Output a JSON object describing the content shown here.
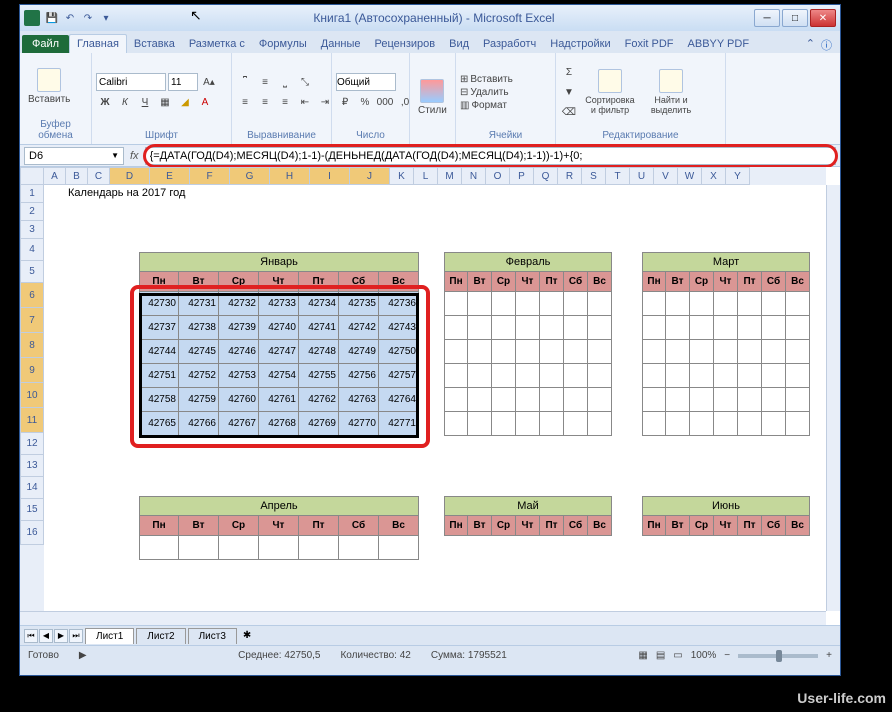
{
  "title": "Книга1 (Автосохраненный) - Microsoft Excel",
  "tabs": {
    "file": "Файл",
    "list": [
      "Главная",
      "Вставка",
      "Разметка с",
      "Формулы",
      "Данные",
      "Рецензиров",
      "Вид",
      "Разработч",
      "Надстройки",
      "Foxit PDF",
      "ABBYY PDF"
    ],
    "active": 0
  },
  "ribbon": {
    "clipboard": {
      "paste": "Вставить",
      "label": "Буфер обмена"
    },
    "font": {
      "name": "Calibri",
      "size": "11",
      "label": "Шрифт"
    },
    "align": {
      "label": "Выравнивание"
    },
    "number": {
      "format": "Общий",
      "label": "Число"
    },
    "styles": {
      "label": "Стили"
    },
    "cells": {
      "insert": "Вставить",
      "delete": "Удалить",
      "format": "Формат",
      "label": "Ячейки"
    },
    "editing": {
      "sort": "Сортировка и фильтр",
      "find": "Найти и выделить",
      "label": "Редактирование"
    }
  },
  "namebox": "D6",
  "formula": "{=ДАТА(ГОД(D4);МЕСЯЦ(D4);1-1)-(ДЕНЬНЕД(ДАТА(ГОД(D4);МЕСЯЦ(D4);1-1))-1)+{0;",
  "columns": [
    "A",
    "B",
    "C",
    "D",
    "E",
    "F",
    "G",
    "H",
    "I",
    "J",
    "K",
    "L",
    "M",
    "N",
    "O",
    "P",
    "Q",
    "R",
    "S",
    "T",
    "U",
    "V",
    "W",
    "X",
    "Y"
  ],
  "rows": [
    1,
    2,
    3,
    4,
    5,
    6,
    7,
    8,
    9,
    10,
    11,
    12,
    13,
    14,
    15,
    16
  ],
  "selected_rows": [
    6,
    7,
    8,
    9,
    10,
    11
  ],
  "cell_a1": "Календарь на 2017 год",
  "months": {
    "jan": "Январь",
    "feb": "Февраль",
    "mar": "Март",
    "apr": "Апрель",
    "may": "Май",
    "jun": "Июнь"
  },
  "days": [
    "Пн",
    "Вт",
    "Ср",
    "Чт",
    "Пт",
    "Сб",
    "Вс"
  ],
  "jan_data": [
    [
      42730,
      42731,
      42732,
      42733,
      42734,
      42735,
      42736
    ],
    [
      42737,
      42738,
      42739,
      42740,
      42741,
      42742,
      42743
    ],
    [
      42744,
      42745,
      42746,
      42747,
      42748,
      42749,
      42750
    ],
    [
      42751,
      42752,
      42753,
      42754,
      42755,
      42756,
      42757
    ],
    [
      42758,
      42759,
      42760,
      42761,
      42762,
      42763,
      42764
    ],
    [
      42765,
      42766,
      42767,
      42768,
      42769,
      42770,
      42771
    ]
  ],
  "sheets": [
    "Лист1",
    "Лист2",
    "Лист3"
  ],
  "status": {
    "ready": "Готово",
    "avg_label": "Среднее:",
    "avg": "42750,5",
    "count_label": "Количество:",
    "count": "42",
    "sum_label": "Сумма:",
    "sum": "1795521",
    "zoom": "100%"
  },
  "watermark": "User-life.com"
}
